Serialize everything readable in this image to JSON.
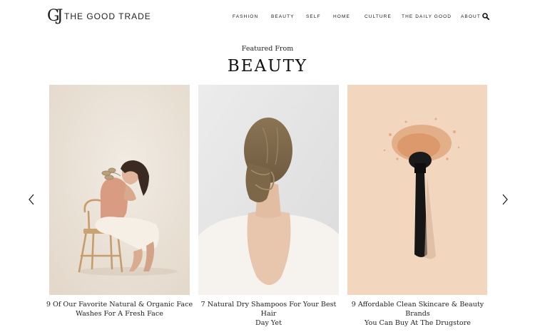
{
  "brand": {
    "logo_mark": "GJ",
    "name": "THE GOOD TRADE"
  },
  "nav": {
    "items": [
      {
        "label": "FASHION"
      },
      {
        "label": "BEAUTY"
      },
      {
        "label": "SELF"
      },
      {
        "label": "HOME"
      },
      {
        "label": "CULTURE"
      },
      {
        "label": "THE DAILY GOOD"
      },
      {
        "label": "ABOUT"
      }
    ],
    "search_icon": "search-icon"
  },
  "section": {
    "eyebrow": "Featured From",
    "title": "BEAUTY"
  },
  "carousel": {
    "prev_icon": "chevron-left-icon",
    "next_icon": "chevron-right-icon",
    "cards": [
      {
        "title_line1": "9 Of Our Favorite Natural & Organic Face",
        "title_line2": "Washes For A Fresh Face",
        "image": "woman-on-chair-photo"
      },
      {
        "title_line1": "7 Natural Dry Shampoos For Your Best Hair",
        "title_line2": "Day Yet",
        "image": "woman-hair-bun-photo"
      },
      {
        "title_line1": "9 Affordable Clean Skincare & Beauty Brands",
        "title_line2": "You Can Buy At The Drugstore",
        "image": "makeup-brush-powder-photo"
      }
    ]
  },
  "colors": {
    "text": "#1a1a1a",
    "card1_bg": "#ede5da",
    "card2_bg": "#e7e6e6",
    "card3_bg": "#f2d6bd"
  }
}
